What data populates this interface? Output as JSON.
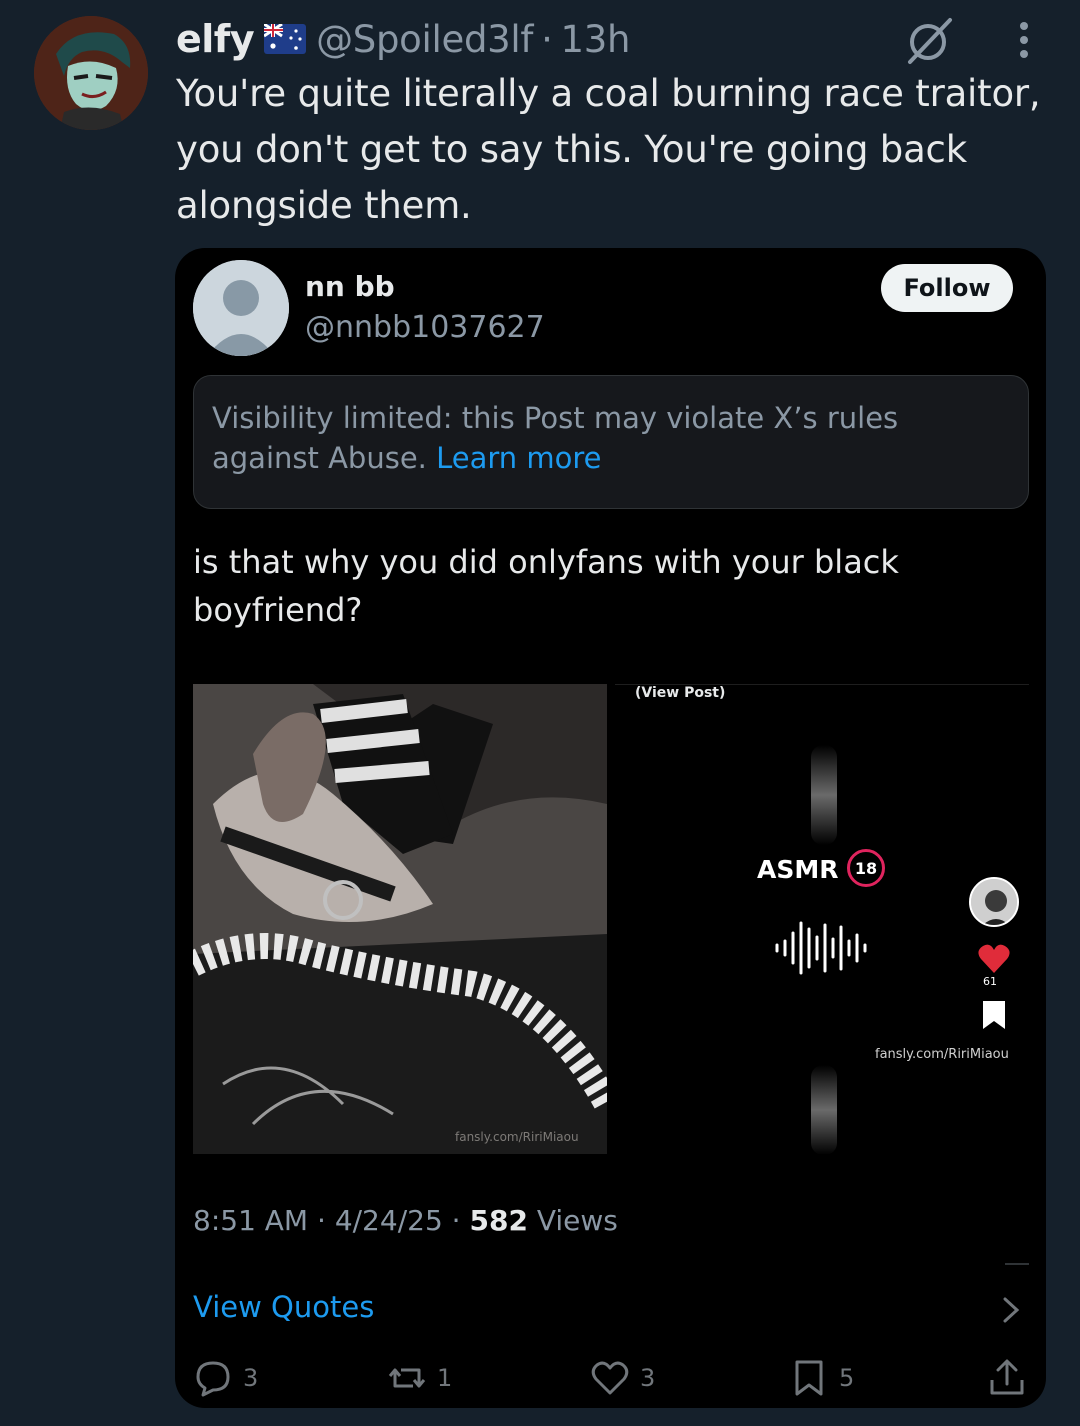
{
  "tweet": {
    "display_name": "elfy",
    "flag": "australia-flag",
    "handle": "@Spoiled3lf",
    "separator": "·",
    "time": "13h",
    "text": "You're quite literally a coal burning race traitor, you don't get to say this. You're going back alongside them."
  },
  "quoted": {
    "display_name": "nn bb",
    "handle": "@nnbb1037627",
    "follow_label": "Follow",
    "notice_text": "Visibility limited: this Post may violate X’s rules against Abuse.",
    "notice_link": "Learn more",
    "text": "is that why you did onlyfans with your black boyfriend?",
    "media": {
      "view_post_label": "(View Post)",
      "asmr_label": "ASMR",
      "age_badge": "18",
      "like_count": "61",
      "fansly_label": "fansly.com/RiriMiaou",
      "watermark": "fansly.com/RiriMiaou"
    },
    "time": "8:51 AM",
    "date": "4/24/25",
    "views_count": "582",
    "views_label": "Views",
    "view_quotes_label": "View Quotes",
    "actions": {
      "replies": "3",
      "reposts": "1",
      "likes": "3",
      "bookmarks": "5"
    }
  },
  "colors": {
    "background": "#15202b",
    "accent": "#1d9bf0",
    "secondary_text": "#8b98a5"
  }
}
